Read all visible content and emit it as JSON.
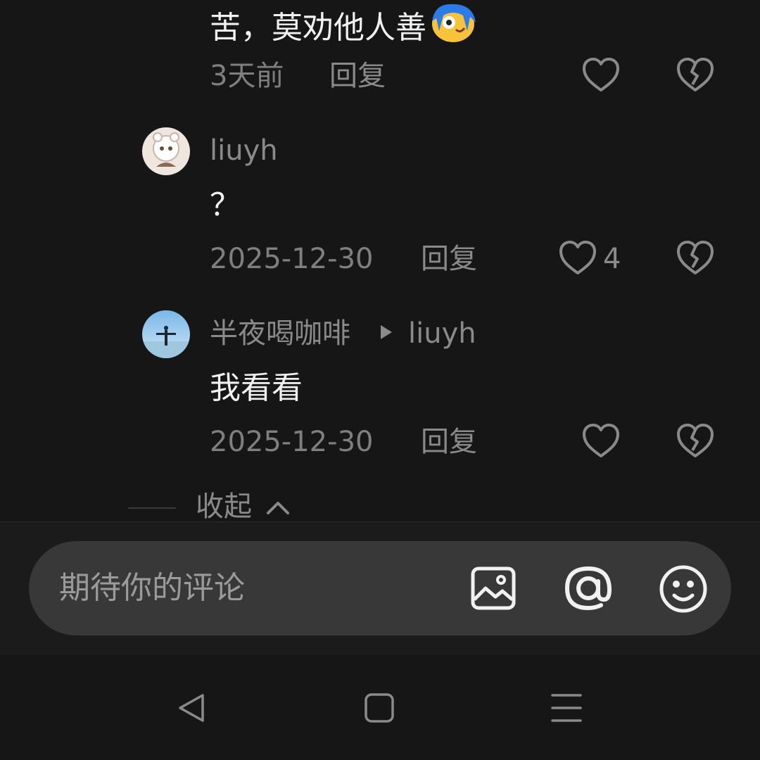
{
  "comments": [
    {
      "text": "苦，莫劝他人善",
      "emoji": "smirk-face-emoji",
      "time": "3天前",
      "reply_label": "回复",
      "likes": ""
    },
    {
      "username": "liuyh",
      "text": "？",
      "time": "2025-12-30",
      "reply_label": "回复",
      "likes": "4"
    },
    {
      "username": "半夜喝咖啡",
      "reply_to": "liuyh",
      "text": "我看看",
      "time": "2025-12-30",
      "reply_label": "回复",
      "likes": ""
    }
  ],
  "collapse_label": "收起",
  "composer": {
    "placeholder": "期待你的评论",
    "icons": [
      "image-icon",
      "at-icon",
      "emoji-icon"
    ]
  },
  "colors": {
    "background": "#161616",
    "pill": "#383838",
    "muted_text": "#8a8a8a",
    "primary_text": "#f1f1f1"
  }
}
